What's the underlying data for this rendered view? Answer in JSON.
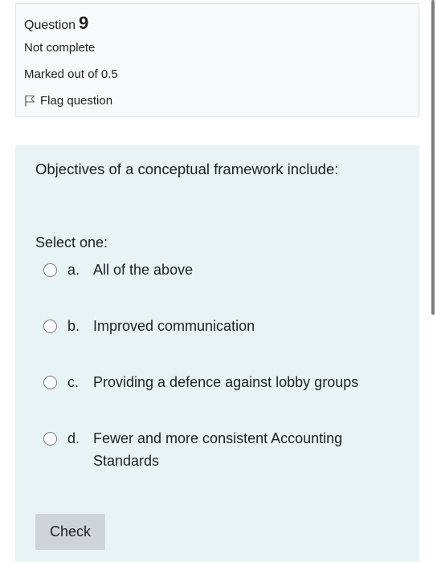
{
  "question_info": {
    "label": "Question",
    "number": "9",
    "state": "Not complete",
    "grade": "Marked out of 0.5",
    "flag_label": "Flag question"
  },
  "question": {
    "text": "Objectives of a conceptual framework include:",
    "prompt": "Select one:",
    "options": [
      {
        "letter": "a.",
        "text": "All of the above"
      },
      {
        "letter": "b.",
        "text": "Improved communication"
      },
      {
        "letter": "c.",
        "text": "Providing a defence against lobby groups"
      },
      {
        "letter": "d.",
        "text": "Fewer and more consistent Accounting Standards"
      }
    ],
    "check_label": "Check"
  },
  "icons": {
    "flag": "flag-icon"
  },
  "colors": {
    "info_background": "#f8f9fa",
    "content_background": "#e7f3f5",
    "button_background": "#ced4da"
  }
}
